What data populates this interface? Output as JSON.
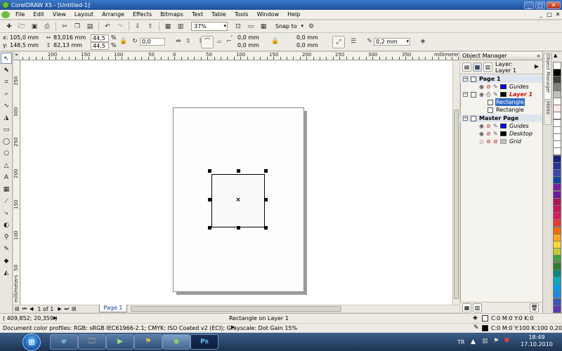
{
  "window": {
    "title": "CorelDRAW X5 - [Untitled-1]",
    "minimize": "_",
    "maximize": "□",
    "close": "✕"
  },
  "menu": {
    "items": [
      "File",
      "Edit",
      "View",
      "Layout",
      "Arrange",
      "Effects",
      "Bitmaps",
      "Text",
      "Table",
      "Tools",
      "Window",
      "Help"
    ],
    "doc_controls": [
      "_",
      "□",
      "✕"
    ]
  },
  "toolbar": {
    "zoom": "37%",
    "snap_to": "Snap to"
  },
  "properties": {
    "x_label": "x:",
    "x_value": "105,0 mm",
    "y_label": "y:",
    "y_value": "148,5 mm",
    "width_value": "83,016 mm",
    "height_value": "82,13 mm",
    "scale_w": "44,5",
    "scale_h": "44,5",
    "percent": "%",
    "rotation": "0,0",
    "corner_tl": "0,0 mm",
    "corner_bl": "0,0 mm",
    "corner_tr": "0,0 mm",
    "corner_br": "0,0 mm",
    "outline_width": "0,2 mm"
  },
  "rulers": {
    "units": "millimeters",
    "h_labels": [
      "200",
      "150",
      "100",
      "50",
      "0",
      "50",
      "100",
      "150",
      "200",
      "250",
      "300",
      "350",
      "400"
    ],
    "v_labels": [
      "350",
      "300",
      "250",
      "200",
      "150",
      "100",
      "50"
    ]
  },
  "page_nav": {
    "counter": "1 of 1",
    "tab": "Page 1"
  },
  "object_manager": {
    "title": "Object Manager",
    "layer_label": "Layer:",
    "layer_name": "Layer 1",
    "tree": [
      {
        "kind": "page",
        "label": "Page 1"
      },
      {
        "kind": "layer",
        "label": "Guides",
        "color": "#0000ff"
      },
      {
        "kind": "layer",
        "label": "Layer 1",
        "color": "#000000",
        "active": true
      },
      {
        "kind": "object",
        "label": "Rectangle",
        "selected": true
      },
      {
        "kind": "object",
        "label": "Rectangle"
      },
      {
        "kind": "page",
        "label": "Master Page"
      },
      {
        "kind": "layer",
        "label": "Guides",
        "color": "#0000ff"
      },
      {
        "kind": "layer",
        "label": "Desktop",
        "color": "#000000"
      },
      {
        "kind": "layer",
        "label": "Grid",
        "color": "#c0c0c0"
      }
    ]
  },
  "side_tabs": {
    "object_manager": "Object Manager",
    "hints": "Hints"
  },
  "palette": [
    "#ffffff",
    "#000000",
    "#404040",
    "#808080",
    "#c0c0c0",
    "#ffffff",
    "#ffe6e6",
    "#ffffff",
    "#ffffff",
    "#ffffff",
    "#ffffff",
    "#ffffff",
    "#ffffff",
    "#1a237e",
    "#283593",
    "#3949ab",
    "#0d47a1",
    "#7b1fa2",
    "#6a1b9a",
    "#ad1457",
    "#c2185b",
    "#d81b60",
    "#e53935",
    "#ef6c00",
    "#f9a825",
    "#fdd835",
    "#c0ca33",
    "#43a047",
    "#2e7d32",
    "#00897b",
    "#00acc1",
    "#039be5",
    "#1e88e5",
    "#3f51b5",
    "#5e35b1",
    "#8e24aa"
  ],
  "status": {
    "coords": "( 409,852; 20,359 )",
    "object_info": "Rectangle on Layer 1",
    "color_profiles": "Document color profiles: RGB: sRGB IEC61966-2.1; CMYK: ISO Coated v2 (ECI); Grayscale: Dot Gain 15%",
    "fill_info": "C:0 M:0 Y:0 K:0",
    "outline_info": "C:0 M:0 Y:100 K:100  0,200 mm"
  },
  "taskbar": {
    "start": "⊞",
    "apps": [
      "e",
      "🗀",
      "▶",
      "⚑",
      "Ps"
    ],
    "language": "TR",
    "time": "18:49",
    "date": "17.10.2010"
  }
}
